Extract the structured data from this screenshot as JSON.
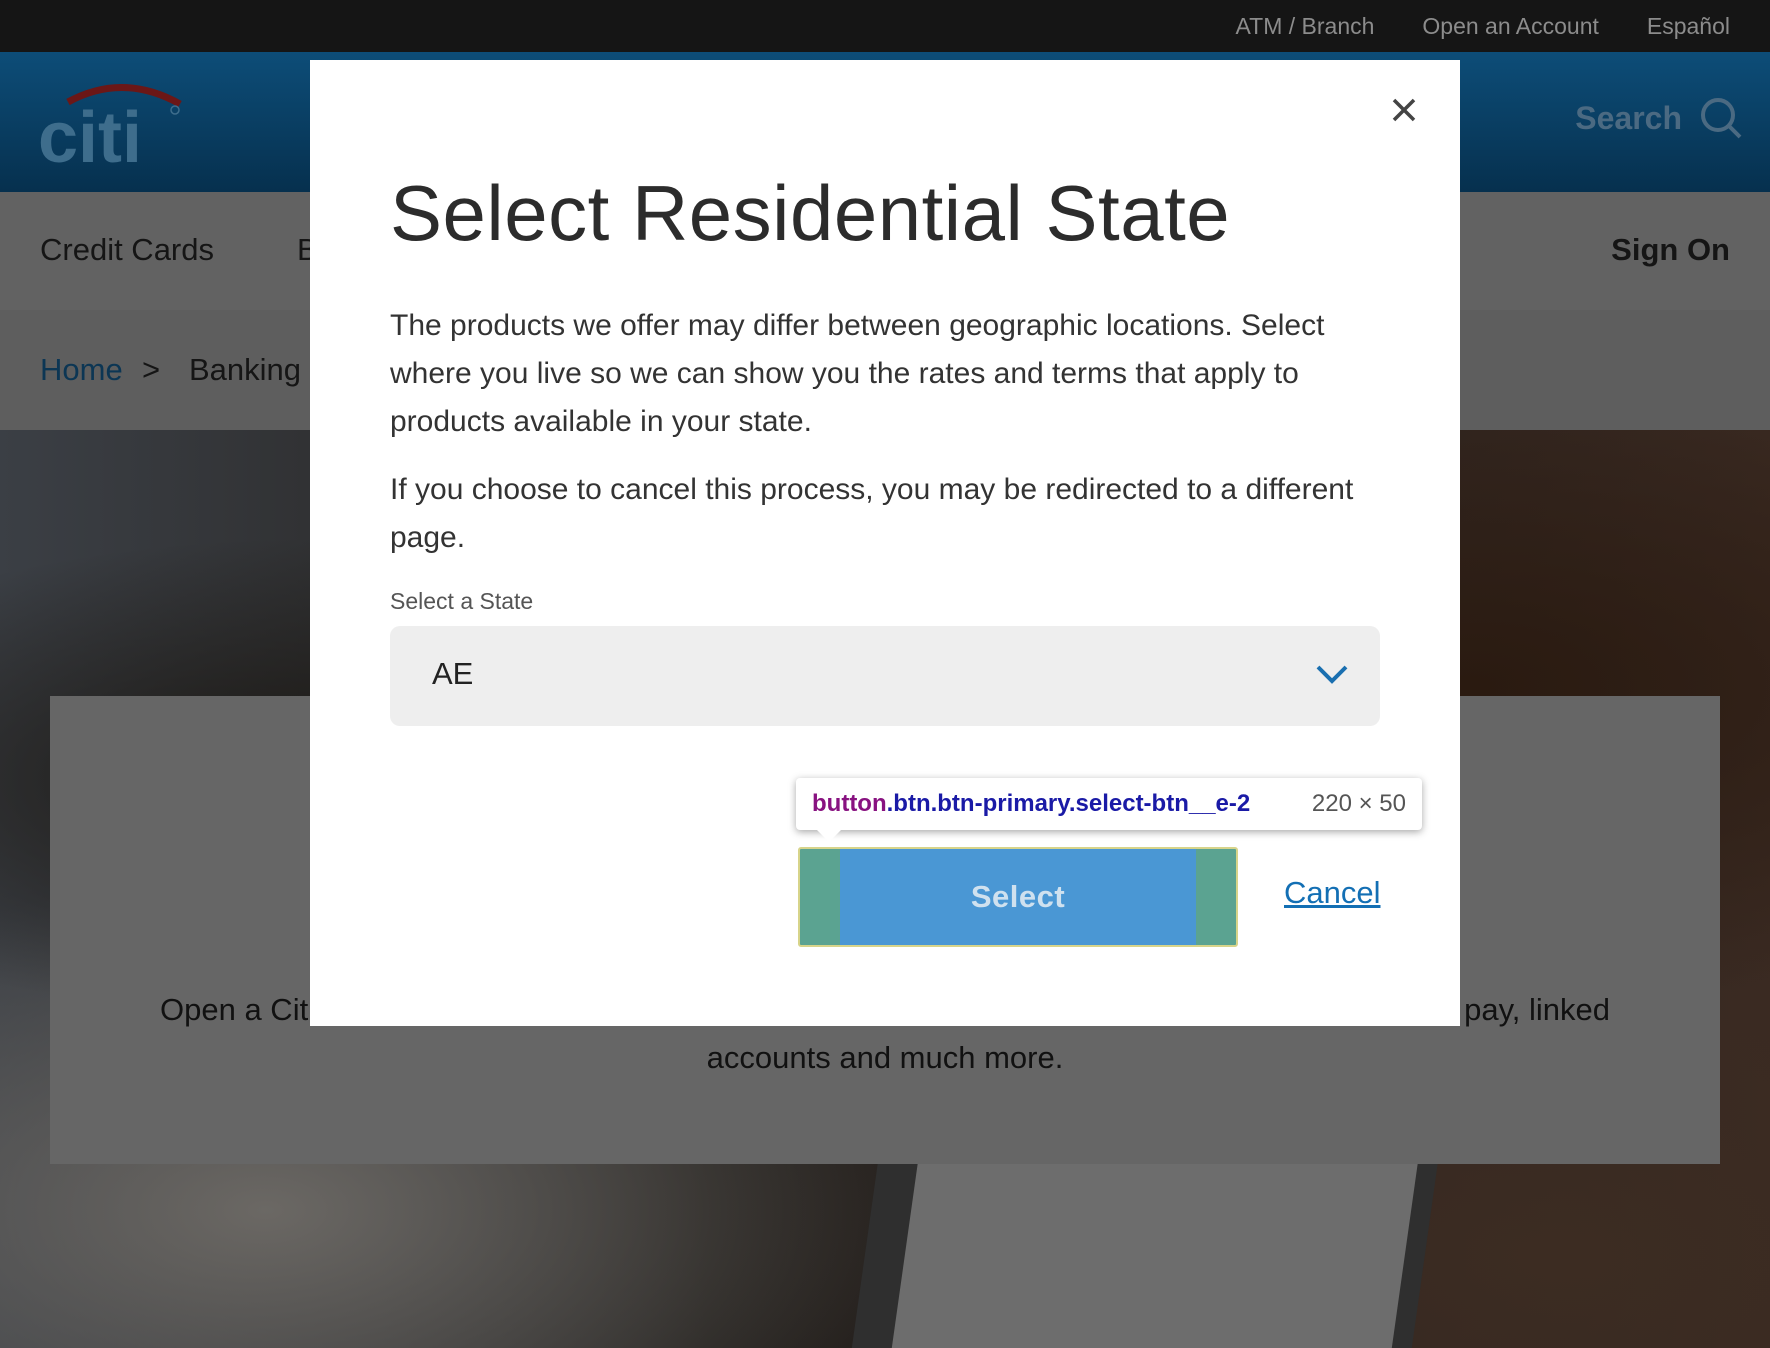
{
  "utility_nav": {
    "atm_branch": "ATM / Branch",
    "open_account": "Open an Account",
    "espanol": "Español"
  },
  "header": {
    "logo_text": "citi",
    "search_label": "Search"
  },
  "main_nav": {
    "credit_cards": "Credit Cards",
    "banking_partial": "B",
    "sign_on": "Sign On"
  },
  "breadcrumb": {
    "home": "Home",
    "separator": ">",
    "banking_partial": "Banking"
  },
  "promo": {
    "line1_left": "Open a Cit",
    "line1_right": "pay, linked",
    "line2": "accounts and much more."
  },
  "modal": {
    "title": "Select Residential State",
    "paragraph1": "The products we offer may differ between geographic locations. Select where you live so we can show you the rates and terms that apply to products available in your state.",
    "paragraph2": "If you choose to cancel this process, you may be redirected to a different page.",
    "state_label": "Select a State",
    "state_value": "AE",
    "select_button": "Select",
    "cancel_link": "Cancel",
    "close_icon": "close-icon"
  },
  "devtools_tooltip": {
    "tag": "button",
    "classes": ".btn.btn-primary.select-btn__e-2",
    "dimensions": "220 × 50"
  },
  "colors": {
    "header_bg": "#0d4d78",
    "link_blue": "#136fb4",
    "button_blue": "#4a97d4",
    "overlay": "#5a5a5a"
  }
}
